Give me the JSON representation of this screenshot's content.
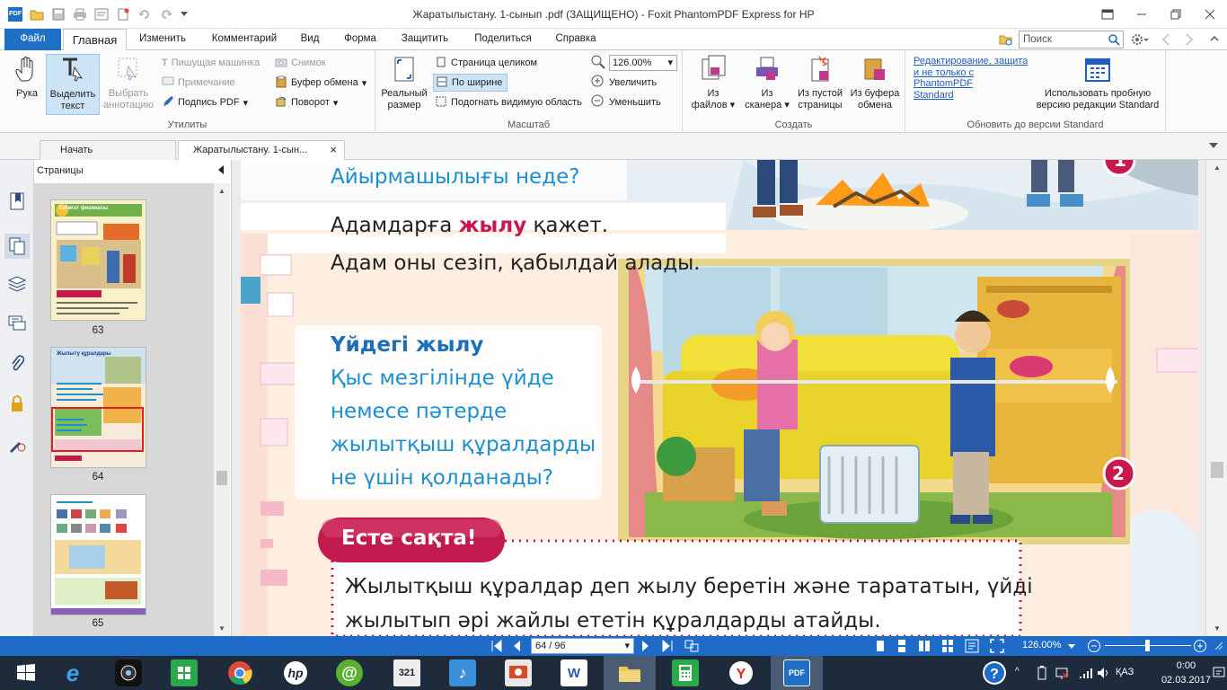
{
  "window": {
    "title": "Жаратылыстану. 1-сынып .pdf (ЗАЩИЩЕНО) - Foxit PhantomPDF Express for HP",
    "logo": "PDF"
  },
  "menu": {
    "tabs": [
      "Файл",
      "Главная",
      "Изменить",
      "Комментарий",
      "Вид",
      "Форма",
      "Защитить",
      "Поделиться",
      "Справка"
    ],
    "search_placeholder": "Поиск"
  },
  "ribbon": {
    "hand": "Рука",
    "select_text_1": "Выделить",
    "select_text_2": "текст",
    "select_annot_1": "Выбрать",
    "select_annot_2": "аннотацию",
    "typewriter": "Пишущая машинка",
    "note": "Примечание",
    "sign": "Подпись PDF",
    "snapshot": "Снимок",
    "clipboard": "Буфер обмена",
    "rotate": "Поворот",
    "group_utils": "Утилиты",
    "actual_1": "Реальный",
    "actual_2": "размер",
    "fit_page": "Страница целиком",
    "fit_width": "По ширине",
    "fit_visible": "Подогнать видимую область",
    "zoom_value": "126.00%",
    "zoom_in": "Увеличить",
    "zoom_out": "Уменьшить",
    "group_zoom": "Масштаб",
    "from_files_1": "Из",
    "from_files_2": "файлов",
    "from_scanner_1": "Из",
    "from_scanner_2": "сканера",
    "from_blank_1": "Из пустой",
    "from_blank_2": "страницы",
    "from_clip_1": "Из буфера",
    "from_clip_2": "обмена",
    "group_create": "Создать",
    "upgrade_link_1": "Редактирование, защита",
    "upgrade_link_2": "и не только с",
    "upgrade_link_3": "PhantomPDF",
    "upgrade_link_4": "Standard",
    "trial_1": "Использовать пробную",
    "trial_2": "версию редакции Standard",
    "group_upgrade": "Обновить до версии Standard"
  },
  "doctabs": {
    "start": "Начать",
    "current": "Жаратылыстану. 1-сын..."
  },
  "pages_panel": {
    "title": "Страницы",
    "thumbs": [
      {
        "label": "63",
        "heading": "Табиғат физикасы"
      },
      {
        "label": "64",
        "heading": "Жылыту құралдары"
      },
      {
        "label": "65",
        "heading": ""
      }
    ]
  },
  "page": {
    "q_diff": "Айырмашылығы неде?",
    "line1_a": "Адамдарға ",
    "line1_b": "жылу",
    "line1_c": " қажет.",
    "line2": "Адам оны сезіп, қабылдай алады.",
    "home_heat": "Үйдегі жылу",
    "q1": "Қыс мезгілінде үйде",
    "q2": "немесе пәтерде",
    "q3": "жылытқыш құралдарды",
    "q4": "не үшін қолданады?",
    "remember": "Есте сақта!",
    "rem1": "Жылытқыш құралдар деп жылу беретін және тарататын, үйді",
    "rem2": "жылытып әрі жайлы ететін құралдарды атайды.",
    "badge1": "1",
    "badge2": "2"
  },
  "status": {
    "page": "64 / 96",
    "zoom": "126.00%"
  },
  "taskbar": {
    "lang": "ҚАЗ",
    "time": "0:00",
    "date": "02.03.2017",
    "calendar": "321"
  },
  "colors": {
    "accent": "#1f6fc5",
    "page_blue": "#1c8fcf",
    "keyword_red": "#c8184e",
    "remember_red": "#c11a4d"
  }
}
